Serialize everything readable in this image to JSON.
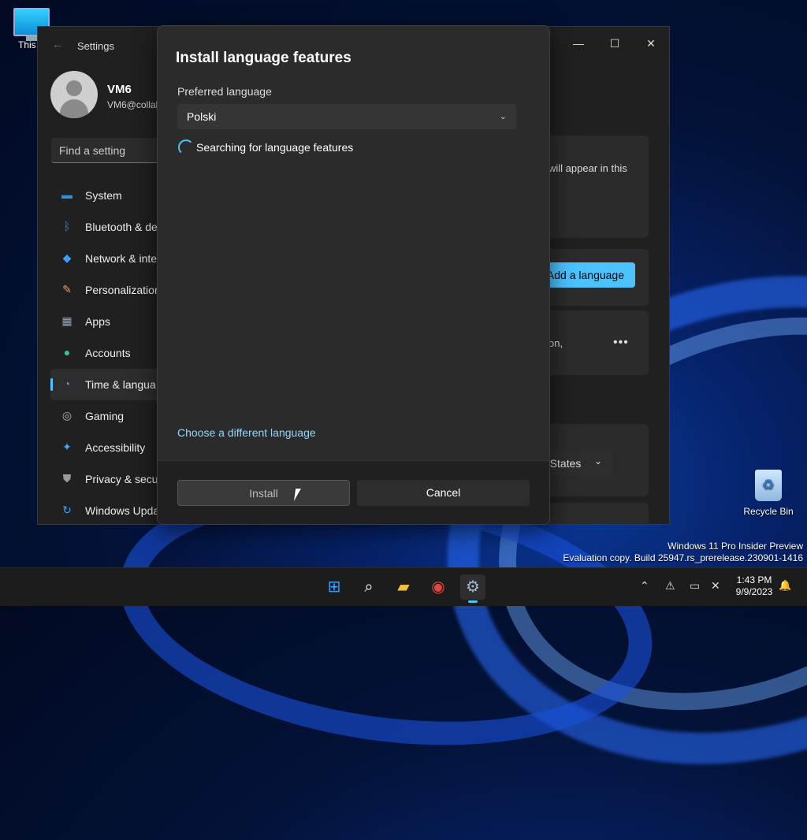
{
  "desktop": {
    "this_pc_label": "This P",
    "recycle_bin_label": "Recycle Bin",
    "watermark_line1": "Windows 11 Pro Insider Preview",
    "watermark_line2": "Evaluation copy. Build 25947.rs_prerelease.230901-1416"
  },
  "settings": {
    "title": "Settings",
    "window_controls": {
      "minimize": "—",
      "maximize": "☐",
      "close": "✕"
    },
    "profile": {
      "name": "VM6",
      "email": "VM6@collal"
    },
    "search_placeholder": "Find a setting",
    "nav": [
      {
        "label": "System",
        "icon": "monitor-icon",
        "glyph": "▬",
        "color": "#2f8fd8"
      },
      {
        "label": "Bluetooth & de",
        "icon": "bluetooth-icon",
        "glyph": "ᛒ",
        "color": "#2f8fd8"
      },
      {
        "label": "Network & inte",
        "icon": "wifi-icon",
        "glyph": "◆",
        "color": "#3aa0ff"
      },
      {
        "label": "Personalization",
        "icon": "brush-icon",
        "glyph": "✎",
        "color": "#e6a15c"
      },
      {
        "label": "Apps",
        "icon": "apps-icon",
        "glyph": "▦",
        "color": "#8fa9c9"
      },
      {
        "label": "Accounts",
        "icon": "person-icon",
        "glyph": "●",
        "color": "#38c49a"
      },
      {
        "label": "Time & langua",
        "icon": "globe-clock-icon",
        "glyph": "◔",
        "color": "#4aa7e6"
      },
      {
        "label": "Gaming",
        "icon": "gamepad-icon",
        "glyph": "◎",
        "color": "#b8b8b8"
      },
      {
        "label": "Accessibility",
        "icon": "accessibility-icon",
        "glyph": "✦",
        "color": "#48a8ff"
      },
      {
        "label": "Privacy & secu",
        "icon": "shield-icon",
        "glyph": "⛊",
        "color": "#9a9a9a"
      },
      {
        "label": "Windows Upda",
        "icon": "update-icon",
        "glyph": "↻",
        "color": "#3aa0ff"
      }
    ],
    "active_nav_index": 6,
    "right": {
      "card1_text": "will appear in this",
      "add_language_label": "Add a language",
      "card3_text": "on,",
      "more_label": "•••",
      "region_value": "d States",
      "region_chevron": "⌄"
    }
  },
  "dialog": {
    "title": "Install language features",
    "preferred_language_label": "Preferred language",
    "selected_language": "Polski",
    "select_chevron": "⌄",
    "status_text": "Searching for language features",
    "choose_link": "Choose a different language",
    "install_label": "Install",
    "cancel_label": "Cancel"
  },
  "taskbar": {
    "apps": [
      {
        "name": "start-icon",
        "glyph": "⊞",
        "color": "#3aa0ff"
      },
      {
        "name": "search-icon",
        "glyph": "⌕",
        "color": "#ffffff"
      },
      {
        "name": "file-explorer-icon",
        "glyph": "▰",
        "color": "#f2c23a"
      },
      {
        "name": "chrome-icon",
        "glyph": "◉",
        "color": "#e0463a"
      },
      {
        "name": "settings-icon",
        "glyph": "⚙",
        "color": "#9fb8cf"
      }
    ],
    "active_app_index": 4,
    "tray": {
      "chevron": "⌃",
      "network": "⚠",
      "display": "▭",
      "volume": "✕"
    },
    "time": "1:43 PM",
    "date": "9/9/2023",
    "notification_icon": "🔔"
  }
}
